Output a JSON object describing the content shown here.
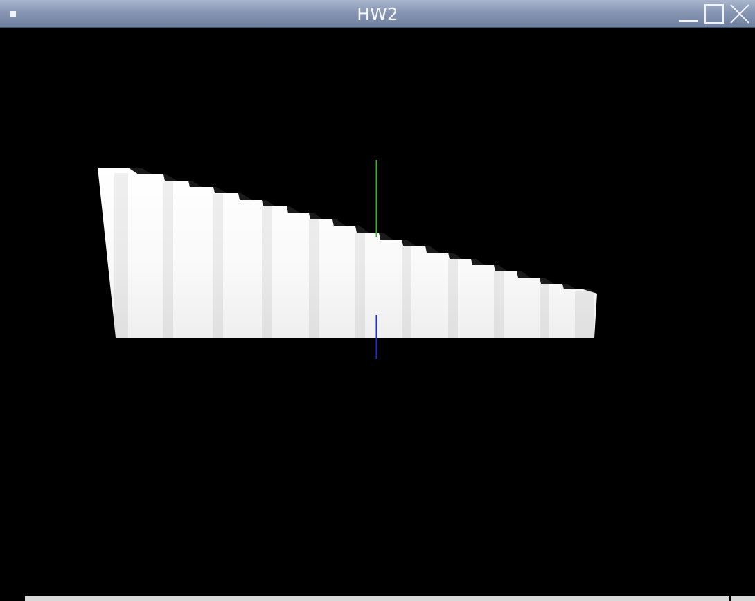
{
  "window": {
    "title": "HW2",
    "menu_icon": "window-menu-icon",
    "controls": {
      "minimize_icon": "minimize-icon",
      "maximize_icon": "maximize-icon",
      "close_icon": "close-icon"
    },
    "colors": {
      "titlebar_top": "#a9b6cd",
      "titlebar_bottom": "#6f7f9f",
      "viewport_background": "#000000"
    }
  },
  "scene": {
    "background": "#000000",
    "shape_color": "#ffffff",
    "y_axis_color": "#3fae2a",
    "z_axis_color": "#2030d0"
  }
}
